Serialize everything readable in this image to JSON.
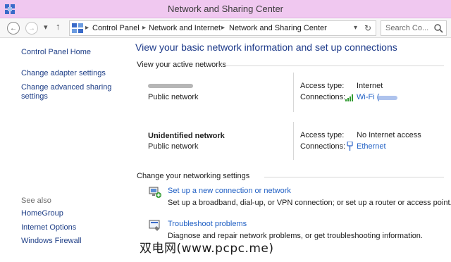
{
  "window": {
    "title": "Network and Sharing Center"
  },
  "nav": {
    "breadcrumb": [
      "Control Panel",
      "Network and Internet",
      "Network and Sharing Center"
    ],
    "search_placeholder": "Search Co..."
  },
  "sidebar": {
    "links": [
      "Control Panel Home",
      "Change adapter settings",
      "Change advanced sharing settings"
    ],
    "see_also_label": "See also",
    "see_also": [
      "HomeGroup",
      "Internet Options",
      "Windows Firewall"
    ]
  },
  "main": {
    "heading": "View your basic network information and set up connections",
    "active_networks_label": "View your active networks",
    "networks": [
      {
        "name": "",
        "type": "Public network",
        "access_key": "Access type:",
        "access_value": "Internet",
        "conn_key": "Connections:",
        "conn_value": "Wi-Fi ("
      },
      {
        "name": "Unidentified network",
        "type": "Public network",
        "access_key": "Access type:",
        "access_value": "No Internet access",
        "conn_key": "Connections:",
        "conn_value": "Ethernet"
      }
    ],
    "settings_label": "Change your networking settings",
    "tasks": [
      {
        "link": "Set up a new connection or network",
        "desc": "Set up a broadband, dial-up, or VPN connection; or set up a router or access point."
      },
      {
        "link": "Troubleshoot problems",
        "desc": "Diagnose and repair network problems, or get troubleshooting information."
      }
    ]
  },
  "watermark": "双电网(www.pcpc.me)",
  "colors": {
    "titlebar": "#f0c8f0",
    "link": "#1f5fc4",
    "heading": "#1e3b8a"
  }
}
